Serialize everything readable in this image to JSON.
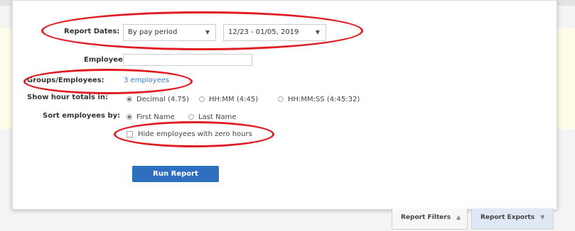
{
  "form": {
    "report_dates_label": "Report Dates:",
    "date_mode_value": "By pay period",
    "date_range_value": "12/23 - 01/05, 2019",
    "employee_label": "Employee:",
    "employee_value": "",
    "groups_label": "Groups/Employees:",
    "groups_link": "3 employees",
    "show_hour_label": "Show hour totals in:",
    "hour_options": [
      {
        "label": "Decimal (4.75)",
        "selected": true
      },
      {
        "label": "HH:MM (4:45)",
        "selected": false
      },
      {
        "label": "HH:MM:SS (4:45:32)",
        "selected": false
      }
    ],
    "sort_label": "Sort employees by:",
    "sort_options": [
      {
        "label": "First Name",
        "selected": true
      },
      {
        "label": "Last Name",
        "selected": false
      }
    ],
    "hide_zero_label": "Hide employees with zero hours",
    "hide_zero_checked": false,
    "run_button": "Run Report"
  },
  "tabs": {
    "filters_label": "Report Filters",
    "exports_label": "Report Exports"
  },
  "icons": {
    "dropdown": "triangle-down-icon",
    "tab_caret_up": "caret-up-icon",
    "tab_caret_down": "caret-down-icon"
  },
  "colors": {
    "annotation": "#e01b22",
    "link": "#3b7dc9",
    "primary_button": "#2f6fc0"
  }
}
